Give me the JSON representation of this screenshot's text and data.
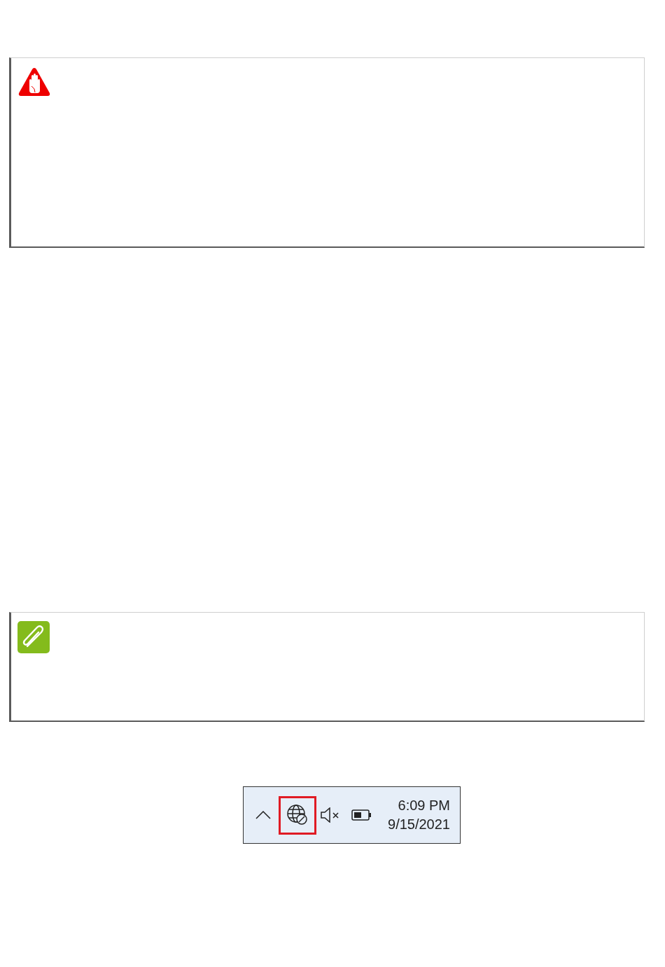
{
  "notices": [
    {
      "kind": "warning"
    },
    {
      "kind": "note"
    }
  ],
  "tray": {
    "icons": [
      {
        "kind": "chevron",
        "highlighted": false
      },
      {
        "kind": "network",
        "highlighted": true
      },
      {
        "kind": "muted_speaker",
        "highlighted": false
      },
      {
        "kind": "battery",
        "highlighted": false
      }
    ],
    "time": "6:09 PM",
    "date": "9/15/2021"
  }
}
